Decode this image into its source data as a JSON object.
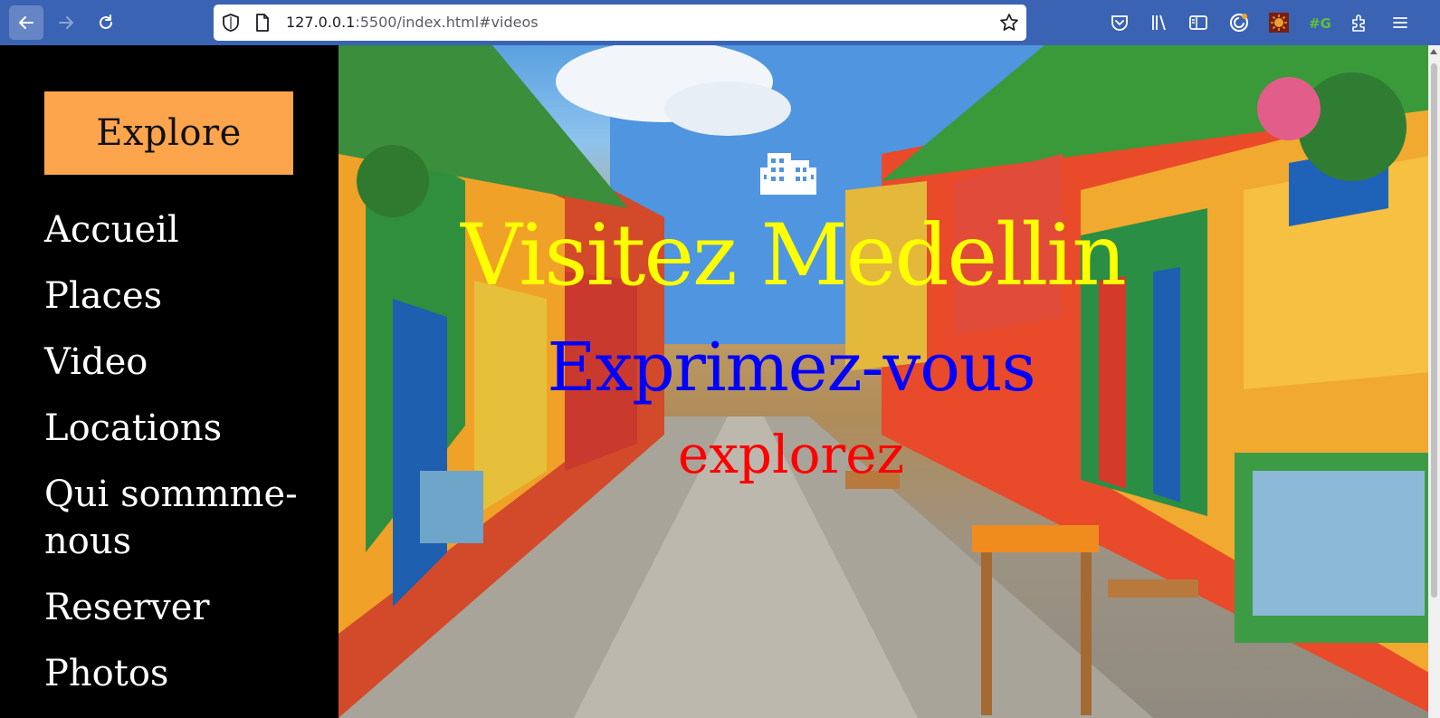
{
  "browser": {
    "url_host": "127.0.0.1",
    "url_rest": ":5500/index.html#videos",
    "icons": [
      "back-arrow-icon",
      "forward-arrow-icon",
      "reload-icon",
      "shield-icon",
      "page-icon",
      "bookmark-star-icon",
      "pocket-icon",
      "library-icon",
      "sidebar-icon",
      "account-icon",
      "extension-sun-icon",
      "extension-g-icon",
      "extensions-puzzle-icon",
      "menu-icon"
    ]
  },
  "sidebar": {
    "explore_label": "Explore",
    "items": [
      {
        "label": "Accueil"
      },
      {
        "label": "Places"
      },
      {
        "label": "Video"
      },
      {
        "label": "Locations"
      },
      {
        "label": "Qui sommme-nous"
      },
      {
        "label": "Reserver"
      },
      {
        "label": "Photos"
      }
    ]
  },
  "hero": {
    "icon": "building-icon",
    "title": "Visitez Medellin",
    "subtitle": "Exprimez-vous",
    "tagline": "explorez"
  },
  "colors": {
    "toolbar": "#3b63b4",
    "explore_button": "#fda54c",
    "title": "#ffff00",
    "subtitle": "#0000ff",
    "tagline": "#ff0000"
  }
}
